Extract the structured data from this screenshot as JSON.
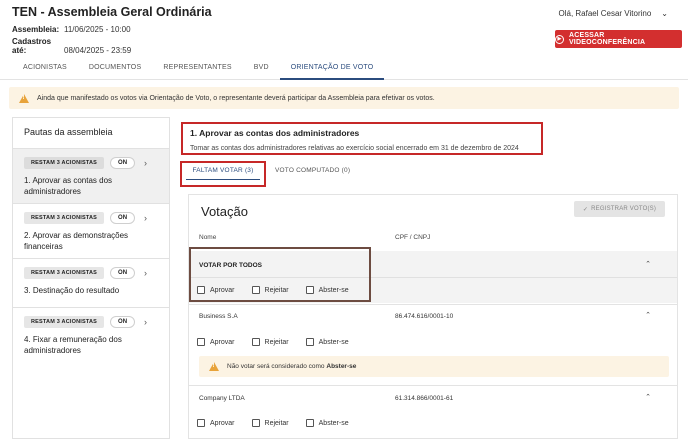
{
  "header": {
    "title": "TEN - Assembleia Geral Ordinária",
    "assembly_label": "Assembleia:",
    "assembly_date": "11/06/2025 - 10:00",
    "signup_label": "Cadastros até:",
    "signup_date": "08/04/2025 - 23:59",
    "greeting": "Olá, Rafael Cesar Vitorino",
    "video_button": "ACESSAR VIDEOCONFERÊNCIA"
  },
  "tabs": [
    {
      "label": "ACIONISTAS"
    },
    {
      "label": "DOCUMENTOS"
    },
    {
      "label": "REPRESENTANTES"
    },
    {
      "label": "BVD"
    },
    {
      "label": "ORIENTAÇÃO DE VOTO",
      "active": true
    }
  ],
  "alert": {
    "text": "Ainda que manifestado os votos via Orientação de Voto, o representante deverá participar da Assembleia para efetivar os votos."
  },
  "sidebar": {
    "title": "Pautas da assembleia",
    "items": [
      {
        "badge": "RESTAM 3 ACIONISTAS",
        "toggle": "ON",
        "label": "1. Aprovar as contas dos administradores",
        "selected": true
      },
      {
        "badge": "RESTAM 3 ACIONISTAS",
        "toggle": "ON",
        "label": "2. Aprovar as demonstrações financeiras"
      },
      {
        "badge": "RESTAM 3 ACIONISTAS",
        "toggle": "ON",
        "label": "3. Destinação do resultado"
      },
      {
        "badge": "RESTAM 3 ACIONISTAS",
        "toggle": "ON",
        "label": "4. Fixar a remuneração dos administradores"
      }
    ]
  },
  "question": {
    "title": "1. Aprovar as contas dos administradores",
    "description": "Tomar as contas dos administradores relativas ao exercício social encerrado em 31 de dezembro de 2024"
  },
  "vote_tabs": [
    {
      "label": "FALTAM VOTAR (3)",
      "active": true
    },
    {
      "label": "VOTO COMPUTADO (0)"
    }
  ],
  "panel": {
    "title": "Votação",
    "register_button": "REGISTRAR VOTO(S)",
    "col_name": "Nome",
    "col_doc": "CPF / CNPJ",
    "all_label": "VOTAR POR TODOS",
    "options": [
      "Aprovar",
      "Rejeitar",
      "Abster-se"
    ],
    "shareholders": [
      {
        "name": "Business S.A",
        "doc": "86.474.616/0001-10"
      },
      {
        "name": "Company LTDA",
        "doc": "61.314.866/0001-61"
      }
    ],
    "note_prefix": "Não votar será considerado como",
    "note_bold": "Abster-se"
  },
  "colors": {
    "accent": "#2b4c7e",
    "danger": "#d32f2f",
    "warning_bg": "#fcf3e3",
    "warning_icon": "#e8a33a"
  }
}
